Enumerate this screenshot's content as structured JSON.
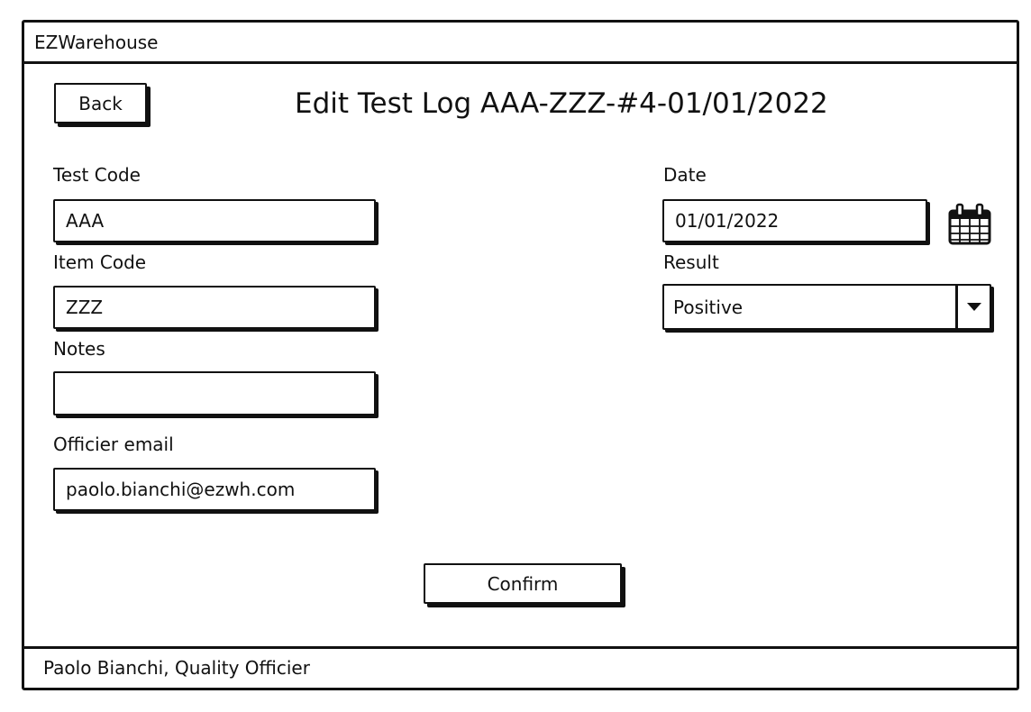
{
  "app": {
    "title": "EZWarehouse"
  },
  "header": {
    "back_label": "Back",
    "page_title": "Edit Test Log AAA-ZZZ-#4-01/01/2022"
  },
  "form": {
    "test_code": {
      "label": "Test Code",
      "value": "AAA"
    },
    "item_code": {
      "label": "Item Code",
      "value": "ZZZ"
    },
    "notes": {
      "label": "Notes",
      "value": ""
    },
    "officer_email": {
      "label": "Officier email",
      "value": "paolo.bianchi@ezwh.com"
    },
    "date": {
      "label": "Date",
      "value": "01/01/2022",
      "icon": "calendar-icon"
    },
    "result": {
      "label": "Result",
      "value": "Positive",
      "icon": "chevron-down-icon"
    }
  },
  "actions": {
    "confirm_label": "Confirm"
  },
  "footer": {
    "user_text": "Paolo Bianchi, Quality Officier"
  }
}
